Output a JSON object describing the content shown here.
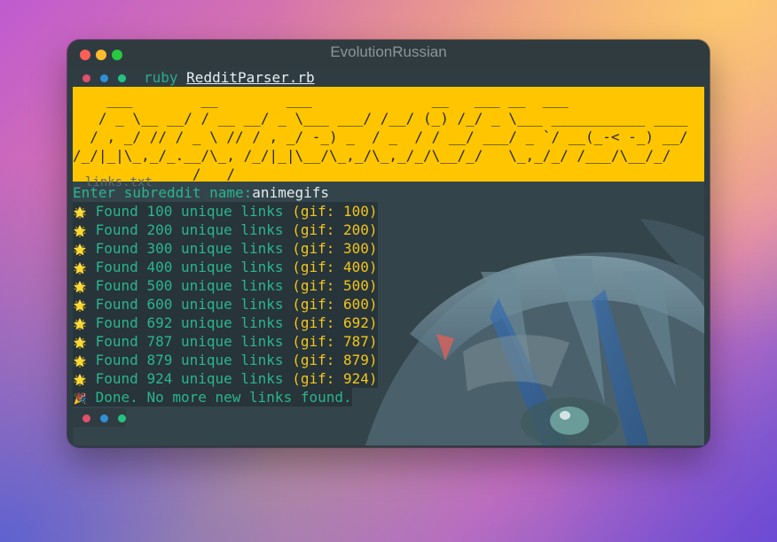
{
  "window": {
    "title": "EvolutionRussian"
  },
  "tab": {
    "command": "ruby",
    "file": "RedditParser.rb"
  },
  "banner": {
    "lines": [
      "    ___        __        ___              __   ___ __  ___",
      "   / _ \\__ __/ / __ __/ _ \\___ ___/ /__/ (_) /_/ _ \\___ ___________ ____",
      "  / , _/ // / _ \\ // / , _/ -_) _  / _  / / __/ ___/ _ `/ __(_-< -_) __/",
      "/_/|_|\\_,_/_.__/\\_, /_/|_|\\__/\\_,_/\\_,_/_/\\__/_/   \\_,_/_/ /___/\\__/_/",
      "              /___/"
    ],
    "bg": "#ffc600"
  },
  "ghost_text": "links.txt",
  "prompt": {
    "label": "Enter subreddit name:",
    "value": "animegifs"
  },
  "results": [
    {
      "text": "Found 100 unique links",
      "gif": "(gif: 100)"
    },
    {
      "text": "Found 200 unique links",
      "gif": "(gif: 200)"
    },
    {
      "text": "Found 300 unique links",
      "gif": "(gif: 300)"
    },
    {
      "text": "Found 400 unique links",
      "gif": "(gif: 400)"
    },
    {
      "text": "Found 500 unique links",
      "gif": "(gif: 500)"
    },
    {
      "text": "Found 600 unique links",
      "gif": "(gif: 600)"
    },
    {
      "text": "Found 692 unique links",
      "gif": "(gif: 692)"
    },
    {
      "text": "Found 787 unique links",
      "gif": "(gif: 787)"
    },
    {
      "text": "Found 879 unique links",
      "gif": "(gif: 879)"
    },
    {
      "text": "Found 924 unique links",
      "gif": "(gif: 924)"
    }
  ],
  "result_icon": "star-icon",
  "done": {
    "icon": "party-popper-icon",
    "text": "Done. No more new links found."
  },
  "colors": {
    "accent_green": "#2bb58e",
    "accent_yellow": "#f2c51c",
    "terminal_bg": "#2e3c43"
  }
}
